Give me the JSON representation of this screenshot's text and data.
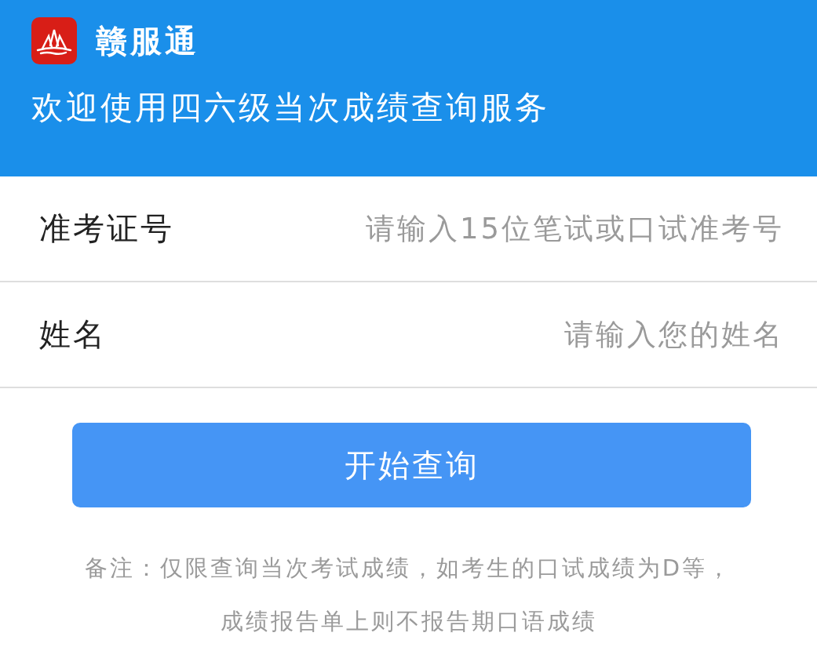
{
  "header": {
    "app_name": "赣服通",
    "welcome": "欢迎使用四六级当次成绩查询服务"
  },
  "form": {
    "fields": [
      {
        "label": "准考证号",
        "placeholder": "请输入15位笔试或口试准考号"
      },
      {
        "label": "姓名",
        "placeholder": "请输入您的姓名"
      }
    ]
  },
  "submit_button": {
    "label": "开始查询"
  },
  "note": {
    "lines": [
      "备注：仅限查询当次考试成绩，如考生的口试成绩为D等，",
      "成绩报告单上则不报告期口语成绩"
    ]
  }
}
